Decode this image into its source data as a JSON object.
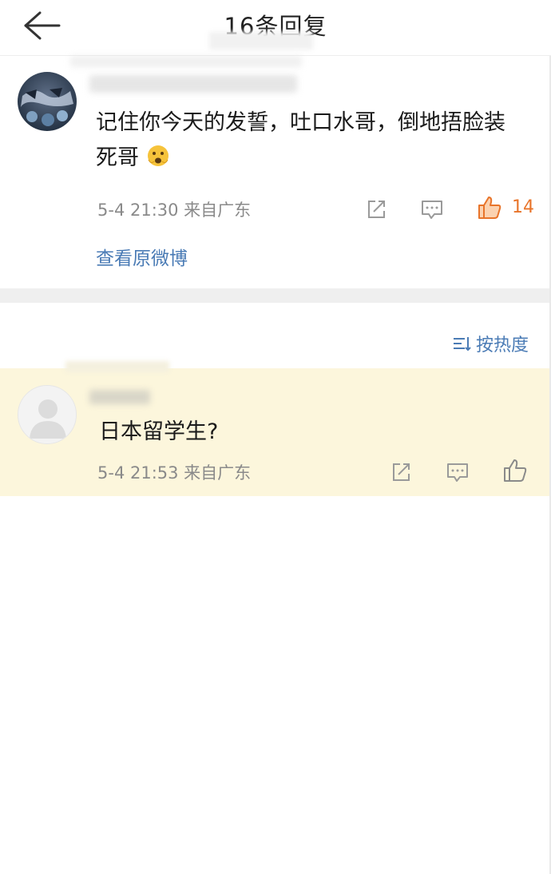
{
  "header": {
    "title": "16条回复",
    "back_icon": "back-arrow-icon"
  },
  "main_comment": {
    "text_line1": "记住你今天的发誓，吐口水哥，倒地捂脸装",
    "text_line2": "死哥",
    "emoji": "scared-face-emoji",
    "time_location": "5-4 21:30 来自广东",
    "like_count": "14",
    "liked": true,
    "view_original": "查看原微博",
    "like_color": "#e8742a"
  },
  "sort": {
    "label": "按热度",
    "icon": "sort-icon"
  },
  "reply": {
    "text": "日本留学生?",
    "time_location": "5-4 21:53 来自广东",
    "highlight_color": "#fcf6dc"
  },
  "colors": {
    "link": "#4a7bb5",
    "meta": "#8a8a8a",
    "divider": "#efefef"
  }
}
